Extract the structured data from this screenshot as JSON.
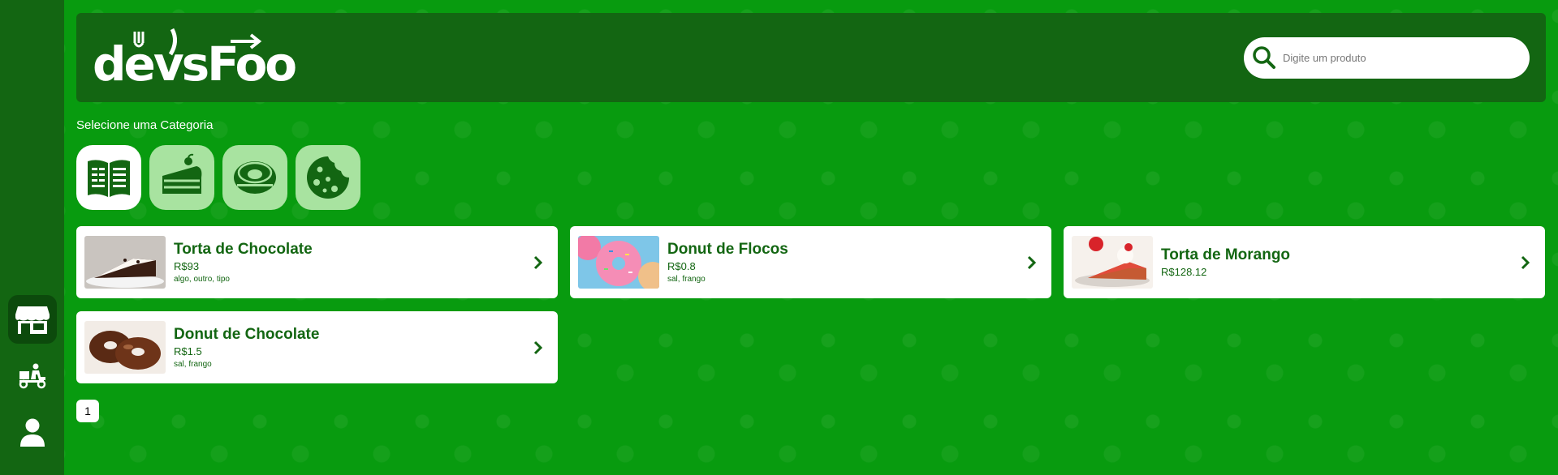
{
  "app": {
    "logo_text": "devsFood",
    "colors": {
      "background": "#089b0f",
      "panel": "#136612",
      "accent_text": "#136612",
      "category_inactive": "#a8e3a0",
      "category_active": "#ffffff"
    }
  },
  "sidebar": {
    "items": [
      {
        "name": "store-icon",
        "active": true
      },
      {
        "name": "delivery-icon",
        "active": false
      },
      {
        "name": "user-icon",
        "active": false
      }
    ]
  },
  "search": {
    "placeholder": "Digite um produto",
    "value": ""
  },
  "categories": {
    "title": "Selecione uma Categoria",
    "items": [
      {
        "icon": "menu-book-icon",
        "selected": true
      },
      {
        "icon": "cake-icon",
        "selected": false
      },
      {
        "icon": "donut-icon",
        "selected": false
      },
      {
        "icon": "cookie-icon",
        "selected": false
      }
    ]
  },
  "products": [
    {
      "name": "Torta de Chocolate",
      "price": "R$93",
      "ingredients": "algo, outro, tipo"
    },
    {
      "name": "Donut de Flocos",
      "price": "R$0.8",
      "ingredients": "sal, frango"
    },
    {
      "name": "Torta de Morango",
      "price": "R$128.12",
      "ingredients": ""
    },
    {
      "name": "Donut de Chocolate",
      "price": "R$1.5",
      "ingredients": "sal, frango"
    }
  ],
  "pagination": {
    "pages": [
      "1"
    ]
  }
}
